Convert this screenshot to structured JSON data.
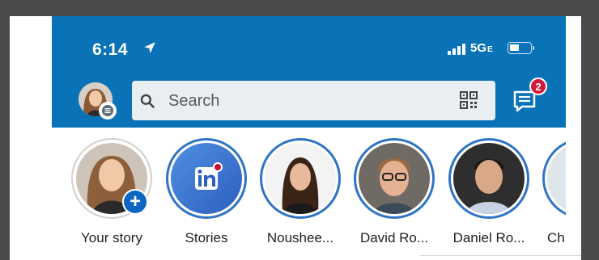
{
  "status_bar": {
    "time": "6:14",
    "network": "5G",
    "network_suffix": "E"
  },
  "header": {
    "search_placeholder": "Search",
    "messages_badge": "2"
  },
  "stories": [
    {
      "label": "Your story"
    },
    {
      "label": "Stories"
    },
    {
      "label": "Noushee..."
    },
    {
      "label": "David Ro..."
    },
    {
      "label": "Daniel Ro..."
    },
    {
      "label": "Ch"
    }
  ],
  "colors": {
    "header_blue": "#0a73b8",
    "ring_blue": "#2f74c4",
    "badge_red": "#d1193a",
    "linkedin_blue": "#0a66c2"
  },
  "icons": {
    "location": "location-arrow-icon",
    "search": "search-icon",
    "qr": "qr-code-icon",
    "messages": "messaging-icon",
    "add_story": "plus-icon",
    "linkedin": "linkedin-logo-icon"
  }
}
